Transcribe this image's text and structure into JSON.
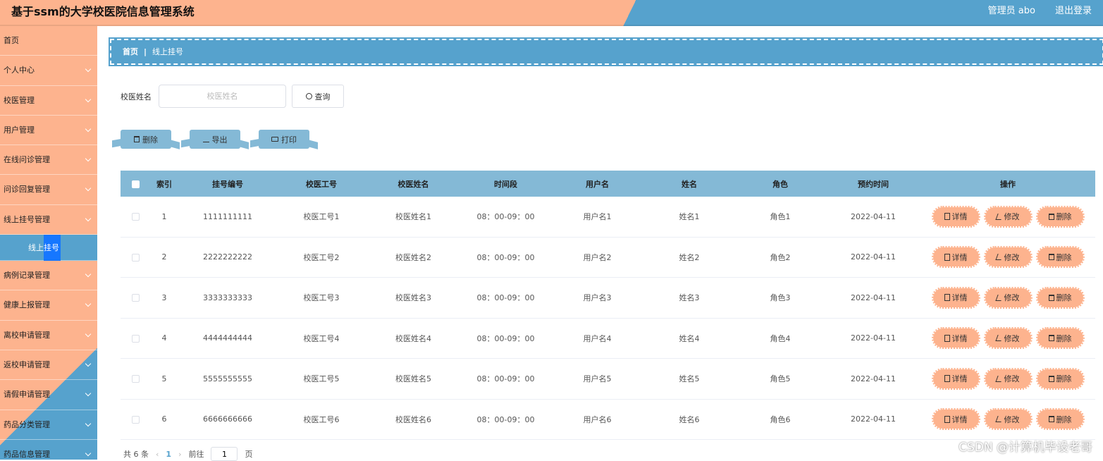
{
  "header": {
    "title": "基于ssm的大学校医院信息管理系统",
    "user": "管理员 abo",
    "logout": "退出登录"
  },
  "sidebar": {
    "items": [
      {
        "label": "首页"
      },
      {
        "label": "个人中心"
      },
      {
        "label": "校医管理"
      },
      {
        "label": "用户管理"
      },
      {
        "label": "在线问诊管理"
      },
      {
        "label": "问诊回复管理"
      },
      {
        "label": "线上挂号管理"
      }
    ],
    "sub_item": "线上挂号",
    "items_after": [
      {
        "label": "病例记录管理"
      },
      {
        "label": "健康上报管理"
      },
      {
        "label": "离校申请管理"
      },
      {
        "label": "返校申请管理"
      },
      {
        "label": "请假申请管理"
      },
      {
        "label": "药品分类管理"
      },
      {
        "label": "药品信息管理"
      }
    ]
  },
  "breadcrumb": {
    "home": "首页",
    "sep": "|",
    "current": "线上挂号"
  },
  "search": {
    "label": "校医姓名",
    "placeholder": "校医姓名",
    "button": "查询"
  },
  "actions": {
    "delete": "删除",
    "export": "导出",
    "print": "打印"
  },
  "table": {
    "headers": [
      "索引",
      "挂号编号",
      "校医工号",
      "校医姓名",
      "时间段",
      "用户名",
      "姓名",
      "角色",
      "预约时间",
      "操作"
    ],
    "rows": [
      [
        "1",
        "1111111111",
        "校医工号1",
        "校医姓名1",
        "08：00-09：00",
        "用户名1",
        "姓名1",
        "角色1",
        "2022-04-11"
      ],
      [
        "2",
        "2222222222",
        "校医工号2",
        "校医姓名2",
        "08：00-09：00",
        "用户名2",
        "姓名2",
        "角色2",
        "2022-04-11"
      ],
      [
        "3",
        "3333333333",
        "校医工号3",
        "校医姓名3",
        "08：00-09：00",
        "用户名3",
        "姓名3",
        "角色3",
        "2022-04-11"
      ],
      [
        "4",
        "4444444444",
        "校医工号4",
        "校医姓名4",
        "08：00-09：00",
        "用户名4",
        "姓名4",
        "角色4",
        "2022-04-11"
      ],
      [
        "5",
        "5555555555",
        "校医工号5",
        "校医姓名5",
        "08：00-09：00",
        "用户名5",
        "姓名5",
        "角色5",
        "2022-04-11"
      ],
      [
        "6",
        "6666666666",
        "校医工号6",
        "校医姓名6",
        "08：00-09：00",
        "用户名6",
        "姓名6",
        "角色6",
        "2022-04-11"
      ]
    ],
    "ops": {
      "detail": "详情",
      "edit": "修改",
      "delete": "删除"
    }
  },
  "pager": {
    "total": "共 6 条",
    "prev": "‹",
    "page": "1",
    "next": "›",
    "goto_label": "前往",
    "goto_value": "1",
    "goto_suffix": "页"
  },
  "watermark": "CSDN @计算机毕设老哥"
}
